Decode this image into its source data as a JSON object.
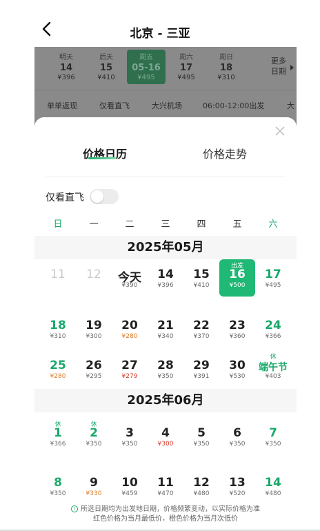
{
  "header": {
    "title": "北京 - 三亚"
  },
  "date_bar": {
    "items": [
      {
        "weekday": "明天",
        "day": "14",
        "price": "¥396",
        "selected": false
      },
      {
        "weekday": "后天",
        "day": "15",
        "price": "¥410",
        "selected": false
      },
      {
        "weekday": "周五",
        "day": "05-16",
        "price": "¥495",
        "selected": true
      },
      {
        "weekday": "周六",
        "day": "17",
        "price": "¥495",
        "selected": false
      },
      {
        "weekday": "周日",
        "day": "18",
        "price": "¥310",
        "selected": false
      }
    ],
    "more_line1": "更多",
    "more_line2": "日期"
  },
  "filters": [
    "单单返现",
    "仅看直飞",
    "大兴机场",
    "06:00-12:00出发",
    "大"
  ],
  "sheet": {
    "tab_active": "价格日历",
    "tab_inactive": "价格走势",
    "direct_only_label": "仅看直飞",
    "direct_only_on": false,
    "weekdays": [
      "日",
      "一",
      "二",
      "三",
      "四",
      "五",
      "六"
    ],
    "months": [
      {
        "title": "2025年05月",
        "rows": [
          [
            null,
            null,
            null,
            null,
            null,
            null,
            null
          ],
          [
            {
              "num": "11",
              "past": true
            },
            {
              "num": "12",
              "past": true
            },
            {
              "num": "今天",
              "price": "¥390"
            },
            {
              "num": "14",
              "price": "¥396"
            },
            {
              "num": "15",
              "price": "¥410"
            },
            {
              "num": "16",
              "price": "¥500",
              "tag": "出发",
              "selected": true
            },
            {
              "num": "17",
              "price": "¥495"
            }
          ],
          [
            {
              "num": "18",
              "price": "¥310"
            },
            {
              "num": "19",
              "price": "¥300"
            },
            {
              "num": "20",
              "price": "¥280",
              "price_color": "second"
            },
            {
              "num": "21",
              "price": "¥340"
            },
            {
              "num": "22",
              "price": "¥370"
            },
            {
              "num": "23",
              "price": "¥360"
            },
            {
              "num": "24",
              "price": "¥366"
            }
          ],
          [
            {
              "num": "25",
              "price": "¥280",
              "price_color": "second"
            },
            {
              "num": "26",
              "price": "¥295"
            },
            {
              "num": "27",
              "price": "¥279",
              "price_color": "low"
            },
            {
              "num": "28",
              "price": "¥350"
            },
            {
              "num": "29",
              "price": "¥391"
            },
            {
              "num": "30",
              "price": "¥530"
            },
            {
              "num": "端午节",
              "price": "¥403",
              "tag": "休",
              "holiday": true
            }
          ]
        ]
      },
      {
        "title": "2025年06月",
        "rows": [
          [
            {
              "num": "1",
              "price": "¥366",
              "tag": "休"
            },
            {
              "num": "2",
              "price": "¥350",
              "tag": "休",
              "holiday": true
            },
            {
              "num": "3",
              "price": "¥350"
            },
            {
              "num": "4",
              "price": "¥300",
              "price_color": "low"
            },
            {
              "num": "5",
              "price": "¥350"
            },
            {
              "num": "6",
              "price": "¥350"
            },
            {
              "num": "7",
              "price": "¥350"
            }
          ],
          [
            {
              "num": "8",
              "price": "¥350"
            },
            {
              "num": "9",
              "price": "¥330",
              "price_color": "second"
            },
            {
              "num": "10",
              "price": "¥459"
            },
            {
              "num": "11",
              "price": "¥470"
            },
            {
              "num": "12",
              "price": "¥480"
            },
            {
              "num": "13",
              "price": "¥520"
            },
            {
              "num": "14",
              "price": "¥480"
            }
          ]
        ]
      }
    ],
    "notice_line1": "所选日期均为出发地日期，价格频繁变动，以实际价格为准",
    "notice_line2": "红色价格为当月最低价，橙色价格为当月次低价"
  },
  "colors": {
    "accent_green": "#1fb874",
    "weekend_green": "#1aa86a",
    "lowest_red": "#d63e2f",
    "second_orange": "#e07a23"
  },
  "icons": {
    "back": "chevron-left-icon",
    "close": "close-icon",
    "info": "info-icon"
  }
}
